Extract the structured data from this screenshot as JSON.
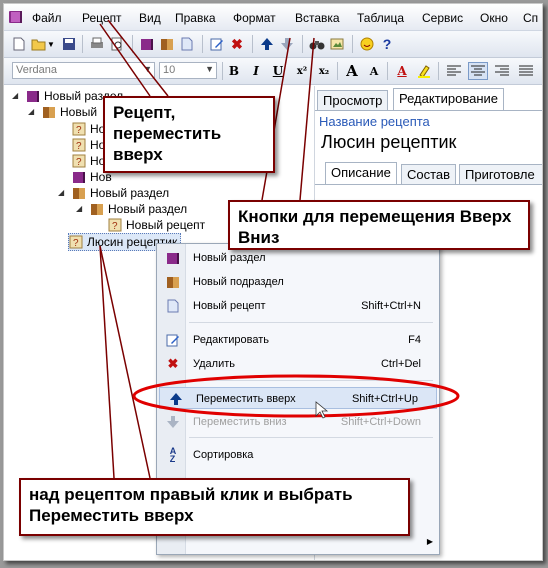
{
  "menu": [
    "Файл",
    "Рецепт",
    "Вид",
    "Правка",
    "Формат",
    "Вставка",
    "Таблица",
    "Сервис",
    "Окно",
    "Сп"
  ],
  "toolbar2": {
    "font": "Verdana",
    "size": "10"
  },
  "tree": {
    "root": "Новый раздел",
    "child": "Новый",
    "r1": "Нов",
    "r2": "Нов",
    "r3": "Нов",
    "r4": "Нов",
    "sec1": "Новый раздел",
    "sec2": "Новый раздел",
    "rec": "Новый рецепт",
    "selected": "Люсин рецептик"
  },
  "right": {
    "tab_view": "Просмотр",
    "tab_edit": "Редактирование",
    "name_label": "Название рецепта",
    "name_value": "Люсин рецептик",
    "sub_tabs": [
      "Описание",
      "Состав",
      "Приготовле"
    ]
  },
  "context_menu": {
    "new_section": "Новый раздел",
    "new_subsection": "Новый подраздел",
    "new_recipe": "Новый рецепт",
    "new_recipe_sc": "Shift+Ctrl+N",
    "edit": "Редактировать",
    "edit_sc": "F4",
    "delete": "Удалить",
    "delete_sc": "Ctrl+Del",
    "move_up": "Переместить вверх",
    "move_up_sc": "Shift+Ctrl+Up",
    "move_down": "Переместить вниз",
    "move_down_sc": "Shift+Ctrl+Down",
    "sort": "Сортировка"
  },
  "callouts": {
    "recipe_up": "Рецепт, переместить вверх",
    "buttons": "Кнопки для перемещения Вверх Вниз",
    "bottom": "над рецептом правый клик и выбрать Переместить вверх"
  },
  "colors": {
    "accent": "#0a3a8a",
    "callout_border": "#7a0000",
    "highlight_ring": "#e00000"
  }
}
